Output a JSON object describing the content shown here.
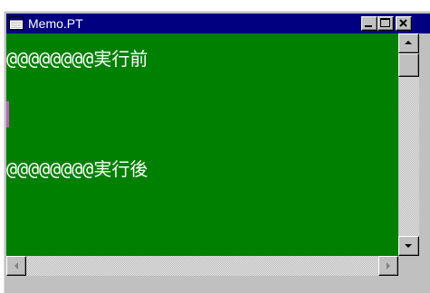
{
  "window": {
    "title": "Memo.PT",
    "app_icon": "notepad-window-icon",
    "controls": {
      "minimize_icon": "minimize-icon",
      "maximize_icon": "maximize-icon",
      "close_icon": "close-icon"
    }
  },
  "editor": {
    "background_color": "#008000",
    "text_color": "#ffffff",
    "caret_color": "#c060c0",
    "lines": [
      "@@@@@@@@実行前",
      "@@@@@@@@実行後"
    ]
  },
  "scrollbars": {
    "vertical": {
      "up_icon": "arrow-up-icon",
      "down_icon": "arrow-down-icon"
    },
    "horizontal": {
      "left_icon": "arrow-left-icon",
      "right_icon": "arrow-right-icon"
    }
  },
  "colors": {
    "titlebar": "#000080",
    "chrome": "#c0c0c0"
  }
}
